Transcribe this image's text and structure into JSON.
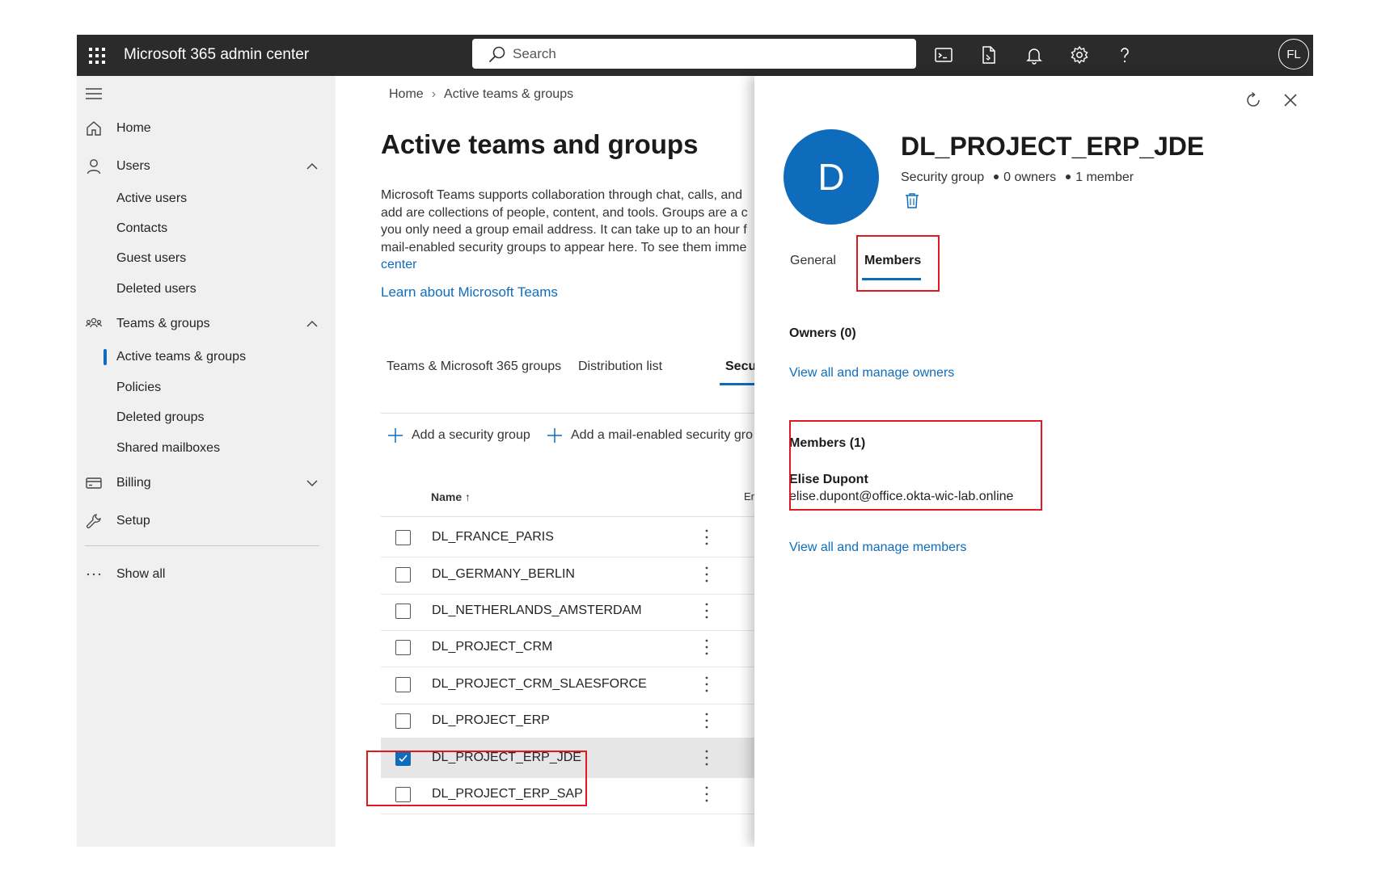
{
  "topbar": {
    "app_title": "Microsoft 365 admin center",
    "search_placeholder": "Search",
    "user_initials": "FL",
    "icons": [
      "waffle-icon",
      "terminal-icon",
      "document-icon",
      "bell-icon",
      "gear-icon",
      "help-icon"
    ]
  },
  "nav": {
    "home": "Home",
    "users": "Users",
    "users_items": [
      "Active users",
      "Contacts",
      "Guest users",
      "Deleted users"
    ],
    "teams": "Teams & groups",
    "teams_items": [
      "Active teams & groups",
      "Policies",
      "Deleted groups",
      "Shared mailboxes"
    ],
    "billing": "Billing",
    "setup": "Setup",
    "show_all": "Show all"
  },
  "main": {
    "breadcrumb": [
      "Home",
      "Active teams & groups"
    ],
    "title": "Active teams and groups",
    "description_lines": [
      "Microsoft Teams supports collaboration through chat, calls, and",
      "add are collections of people, content, and tools. Groups are a c",
      "you only need a group email address. It can take up to an hour f",
      "mail-enabled security groups to appear here. To see them imme"
    ],
    "description_link": "center",
    "learn_link": "Learn about Microsoft Teams",
    "tabs": [
      "Teams & Microsoft 365 groups",
      "Distribution list",
      "Securi"
    ],
    "commands": [
      "Add a security group",
      "Add a mail-enabled security gro"
    ],
    "columns": {
      "name": "Name",
      "sort_arrow": "↑",
      "email": "Em"
    },
    "rows": [
      {
        "name": "DL_FRANCE_PARIS",
        "selected": false
      },
      {
        "name": "DL_GERMANY_BERLIN",
        "selected": false
      },
      {
        "name": "DL_NETHERLANDS_AMSTERDAM",
        "selected": false
      },
      {
        "name": "DL_PROJECT_CRM",
        "selected": false
      },
      {
        "name": "DL_PROJECT_CRM_SLAESFORCE",
        "selected": false
      },
      {
        "name": "DL_PROJECT_ERP",
        "selected": false
      },
      {
        "name": "DL_PROJECT_ERP_JDE",
        "selected": true
      },
      {
        "name": "DL_PROJECT_ERP_SAP",
        "selected": false
      }
    ]
  },
  "panel": {
    "avatar_letter": "D",
    "group_name": "DL_PROJECT_ERP_JDE",
    "group_type": "Security group",
    "owners_count": "0 owners",
    "members_count": "1 member",
    "tabs": [
      "General",
      "Members"
    ],
    "active_tab": "Members",
    "owners_heading": "Owners (0)",
    "owners_link": "View all and manage owners",
    "members_heading": "Members (1)",
    "member": {
      "name": "Elise Dupont",
      "email": "elise.dupont@office.okta-wic-lab.online"
    },
    "members_link": "View all and manage members"
  },
  "colors": {
    "accent": "#0f6cbd",
    "topbar": "#2b2b2b",
    "nav_bg": "#f0f0f0",
    "annotation_red": "#e0191f"
  }
}
